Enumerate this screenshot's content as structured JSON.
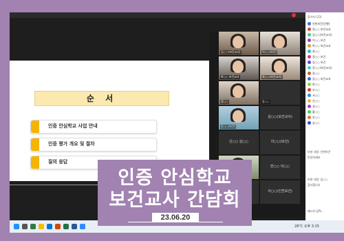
{
  "slide": {
    "title": "순 서",
    "agenda": [
      "인증 안심학교 사업 안내",
      "인증 평가 개요 및 절차",
      "질의 응답"
    ]
  },
  "banner": {
    "line1": "인증 안심학교",
    "line2": "보건교사 간담회",
    "date": "23.06.20"
  },
  "video_grid": {
    "tiles": [
      {
        "name": "김○○(보건교사)",
        "label": ""
      },
      {
        "name": "이○○(보건)",
        "label": ""
      },
      {
        "name": "박○○ 보건교사",
        "label": ""
      },
      {
        "name": "최○○(보건교사)",
        "label": ""
      },
      {
        "name": "정○○",
        "label": ""
      },
      {
        "name": "강○○",
        "label": ""
      },
      {
        "name": "윤○○(보건)",
        "label": ""
      },
      {
        "name": "김○○(보건교사)",
        "label": "김○○(보건교사)"
      },
      {
        "name": "",
        "label": "신○○ 김○○"
      },
      {
        "name": "",
        "label": "이○○(보건)"
      },
      {
        "name": "",
        "label": ""
      },
      {
        "name": "",
        "label": "한○○ 이○○"
      },
      {
        "name": "",
        "label": ""
      },
      {
        "name": "",
        "label": "서○○(인천보건)"
      }
    ]
  },
  "panel": {
    "header": "참가자 (23)",
    "participants": [
      "인천보건(진행)",
      "정○○ 보건교사",
      "김○○(보건교사)",
      "이○○ 보건",
      "박○○ 보건교사",
      "최○○",
      "정○○ 보건",
      "강○○ 보건",
      "윤○○(보건교사)",
      "장○○",
      "임○○ 보건교사",
      "한○○",
      "오○○",
      "서○○",
      "신○○",
      "권○○",
      "황○○",
      "안○○",
      "송○○"
    ],
    "chat": [
      "보낸 사람: 인천보건",
      "안녕하세요",
      "보낸 사람: 김○○",
      "감사합니다",
      "메시지 입력..."
    ]
  },
  "taskbar": {
    "status": "28°C  오후 3:15"
  },
  "colors": {
    "frame": "#a182b0",
    "accent": "#f4b400",
    "slide_title_bg": "#fbe9b0"
  }
}
